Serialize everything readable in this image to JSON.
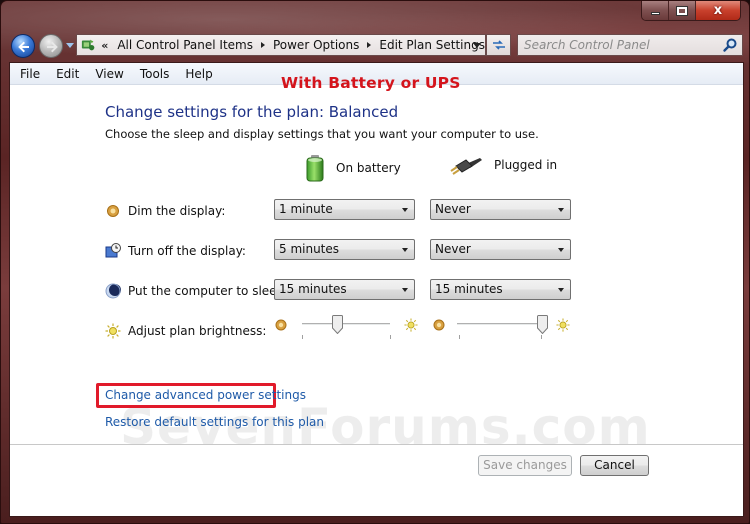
{
  "window": {
    "caption_buttons": [
      "minimize",
      "maximize",
      "close"
    ],
    "close_glyph": "x"
  },
  "navigation": {
    "back_icon": "back-arrow-icon",
    "forward_icon": "forward-arrow-icon",
    "breadcrumb_overflow": "«",
    "breadcrumbs": [
      "All Control Panel Items",
      "Power Options",
      "Edit Plan Settings"
    ],
    "search_placeholder": "Search Control Panel"
  },
  "menu": [
    "File",
    "Edit",
    "View",
    "Tools",
    "Help"
  ],
  "annotation": {
    "title": "With Battery or UPS",
    "color": "#d4141c"
  },
  "content": {
    "title": "Change settings for the plan: Balanced",
    "subtitle": "Choose the sleep and display settings that you want your computer to use.",
    "columns": {
      "battery": {
        "label": "On battery",
        "icon": "battery-icon"
      },
      "plugged": {
        "label": "Plugged in",
        "icon": "power-plug-icon"
      }
    },
    "settings": [
      {
        "label": "Dim the display:",
        "icon": "dim-display-icon",
        "battery": "1 minute",
        "plugged": "Never"
      },
      {
        "label": "Turn off the display:",
        "icon": "display-off-icon",
        "battery": "5 minutes",
        "plugged": "Never"
      },
      {
        "label": "Put the computer to sleep:",
        "icon": "sleep-moon-icon",
        "battery": "15 minutes",
        "plugged": "15 minutes"
      }
    ],
    "brightness": {
      "label": "Adjust plan brightness:",
      "icon": "brightness-sun-icon",
      "battery_percent": 40,
      "plugged_percent": 100
    },
    "links": {
      "advanced": "Change advanced power settings",
      "restore": "Restore default settings for this plan"
    },
    "highlight_color": "#e11a2a"
  },
  "watermark": "SevenForums.com",
  "buttons": {
    "save": {
      "label": "Save changes",
      "enabled": false
    },
    "cancel": {
      "label": "Cancel",
      "enabled": true
    }
  }
}
